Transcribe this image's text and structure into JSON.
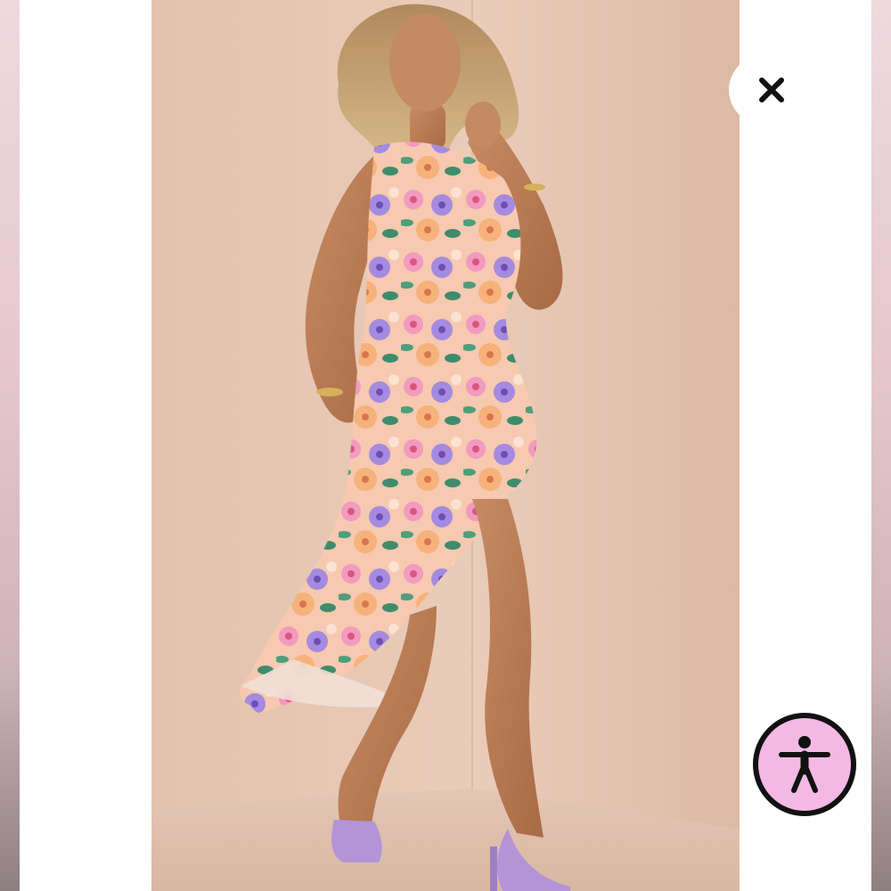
{
  "viewer": {
    "close_icon": "close-icon",
    "accessibility_icon": "accessibility-person-icon"
  },
  "photo": {
    "subject": "floral-dress-product-photo"
  },
  "colors": {
    "accessibility_fill": "#f4b8e4",
    "accessibility_ring": "#111111",
    "close_glyph": "#111111",
    "background": "#ffffff"
  }
}
